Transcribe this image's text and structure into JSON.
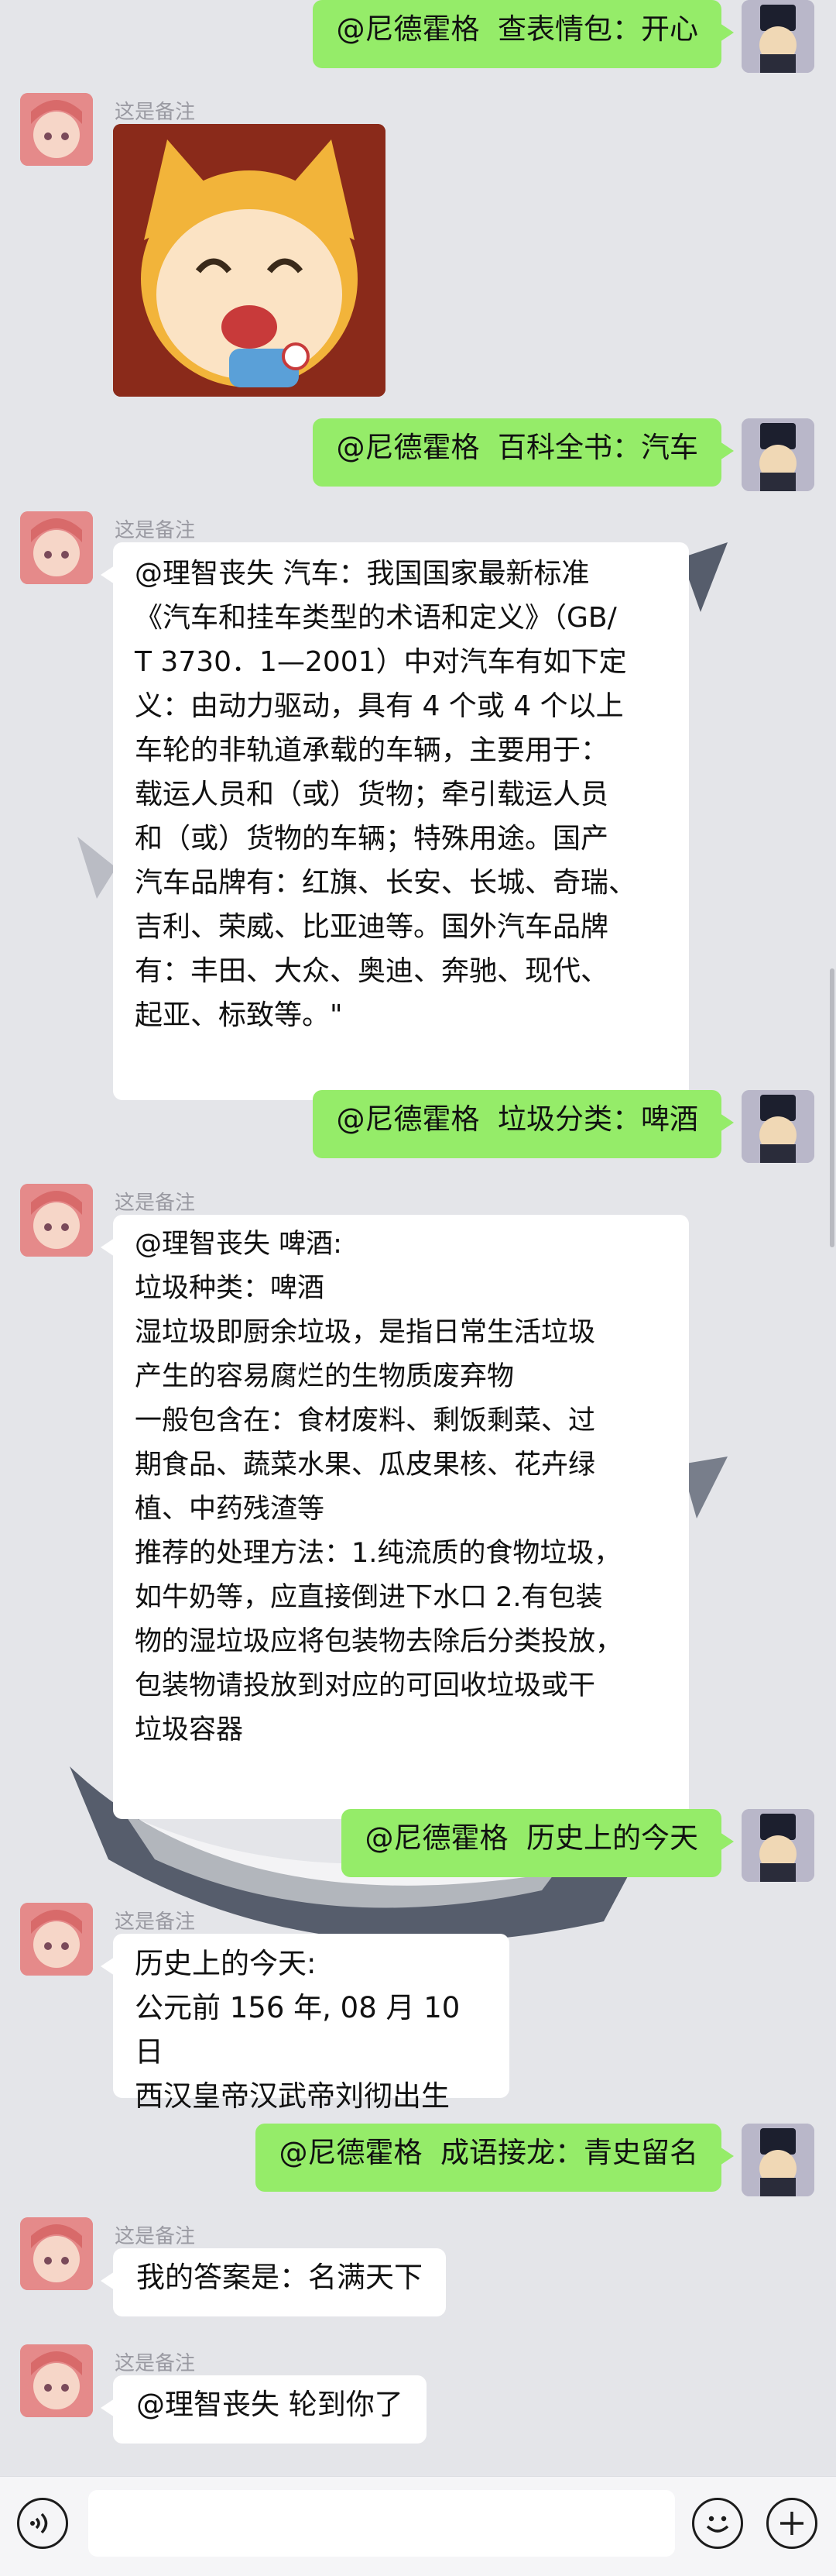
{
  "contacts": {
    "bot_note": "这是备注"
  },
  "messages": [
    {
      "id": "m1",
      "side": "right",
      "text": "@尼德霍格  查表情包：开心"
    },
    {
      "id": "m2",
      "side": "left",
      "type": "sticker"
    },
    {
      "id": "m3",
      "side": "right",
      "text": "@尼德霍格  百科全书：汽车"
    },
    {
      "id": "m4",
      "side": "left",
      "text": "@理智丧失 汽车：我国国家最新标准\n《汽车和挂车类型的术语和定义》（GB/\nT 3730．1—2001）中对汽车有如下定\n义：由动力驱动，具有 4 个或 4 个以上\n车轮的非轨道承载的车辆，主要用于：\n载运人员和（或）货物；牵引载运人员\n和（或）货物的车辆；特殊用途。国产\n汽车品牌有：红旗、长安、长城、奇瑞、\n吉利、荣威、比亚迪等。国外汽车品牌\n有：丰田、大众、奥迪、奔驰、现代、\n起亚、标致等。\""
    },
    {
      "id": "m5",
      "side": "right",
      "text": "@尼德霍格  垃圾分类：啤酒"
    },
    {
      "id": "m6",
      "side": "left",
      "text": "@理智丧失 啤酒:\n垃圾种类：啤酒\n湿垃圾即厨余垃圾，是指日常生活垃圾\n产生的容易腐烂的生物质废弃物\n一般包含在：食材废料、剩饭剩菜、过\n期食品、蔬菜水果、瓜皮果核、花卉绿\n植、中药残渣等\n推荐的处理方法：1.纯流质的食物垃圾，\n如牛奶等，应直接倒进下水口 2.有包装\n物的湿垃圾应将包装物去除后分类投放，\n包装物请投放到对应的可回收垃圾或干\n垃圾容器"
    },
    {
      "id": "m7",
      "side": "right",
      "text": "@尼德霍格  历史上的今天"
    },
    {
      "id": "m8",
      "side": "left",
      "text": "历史上的今天:\n公元前 156 年, 08 月 10 日\n西汉皇帝汉武帝刘彻出生"
    },
    {
      "id": "m9",
      "side": "right",
      "text": "@尼德霍格  成语接龙：青史留名"
    },
    {
      "id": "m10",
      "side": "left",
      "text": "我的答案是：名满天下"
    },
    {
      "id": "m11",
      "side": "left",
      "text": "@理智丧失 轮到你了"
    }
  ],
  "input_bar": {
    "input_value": "",
    "voice_icon": "voice-icon",
    "emoji_icon": "emoji-icon",
    "plus_icon": "plus-icon"
  },
  "colors": {
    "background": "#e4e5e9",
    "sent_bubble": "#95ec69",
    "received_bubble": "#ffffff"
  }
}
